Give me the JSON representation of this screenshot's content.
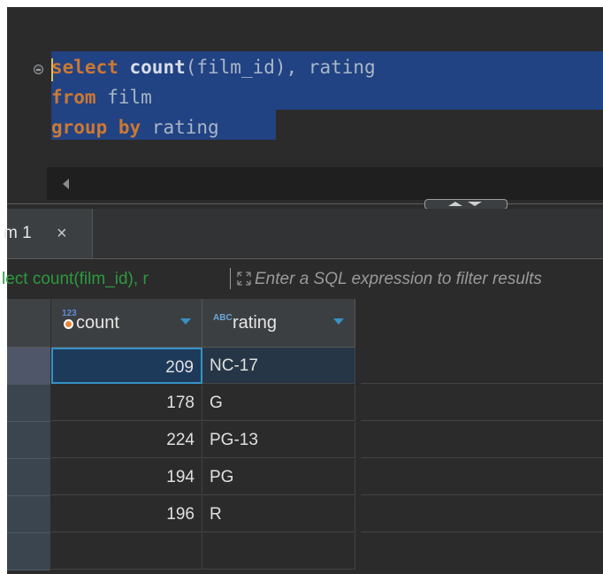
{
  "editor": {
    "line1": {
      "kw1": "select",
      "kw2": "count",
      "rest": "(film_id), rating"
    },
    "line2": {
      "kw": "from",
      "rest": " film"
    },
    "line3": {
      "kw": "group by",
      "rest": " rating"
    }
  },
  "results_tab": {
    "label": "m 1",
    "close": "×"
  },
  "filter": {
    "query_text": "lect count(film_id), r",
    "placeholder": "Enter a SQL expression to filter results"
  },
  "grid": {
    "columns": [
      {
        "type_badge": "123",
        "label": "count"
      },
      {
        "type_badge": "ABC",
        "label": "rating"
      }
    ],
    "rows": [
      {
        "count": "209",
        "rating": "NC-17"
      },
      {
        "count": "178",
        "rating": "G"
      },
      {
        "count": "224",
        "rating": "PG-13"
      },
      {
        "count": "194",
        "rating": "PG"
      },
      {
        "count": "196",
        "rating": "R"
      }
    ]
  },
  "colors": {
    "editor_bg": "#2b2b2b",
    "selection": "#214283",
    "keyword": "#cc7832",
    "filter_query": "#2d9a3e",
    "accent": "#3592c4"
  },
  "icons": [
    "gutter-collapse-icon",
    "scroll-left-icon",
    "splitter-handle-icon",
    "close-icon",
    "filter-expand-icon",
    "sort-dropdown-icon"
  ]
}
